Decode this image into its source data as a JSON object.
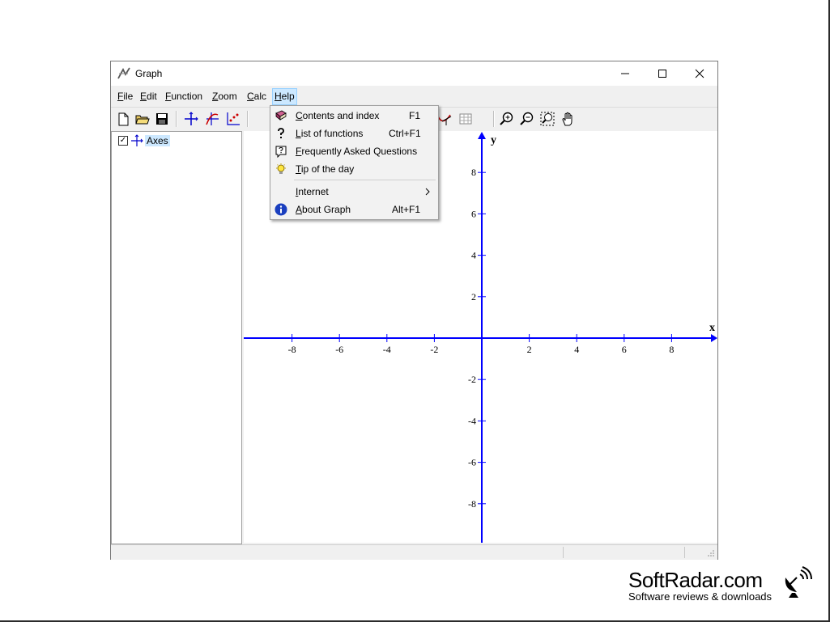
{
  "window": {
    "title": "Graph"
  },
  "menubar": [
    {
      "label": "File",
      "key": "F",
      "rest": "ile"
    },
    {
      "label": "Edit",
      "key": "E",
      "rest": "dit"
    },
    {
      "label": "Function",
      "key": "F",
      "rest": "unction"
    },
    {
      "label": "Zoom",
      "key": "Z",
      "rest": "oom"
    },
    {
      "label": "Calc",
      "key": "C",
      "rest": "alc"
    },
    {
      "label": "Help",
      "key": "H",
      "rest": "elp"
    }
  ],
  "tree": {
    "item_label": "Axes",
    "checked": true
  },
  "help_menu": {
    "items": [
      {
        "key": "C",
        "rest": "ontents and index",
        "shortcut": "F1",
        "icon": "book-icon"
      },
      {
        "key": "L",
        "rest": "ist of functions",
        "shortcut": "Ctrl+F1",
        "icon": "question-icon"
      },
      {
        "key": "F",
        "rest": "requently Asked Questions",
        "shortcut": "",
        "icon": "faq-icon"
      },
      {
        "key": "T",
        "rest": "ip of the day",
        "shortcut": "",
        "icon": "lightbulb-icon"
      },
      {
        "key": "I",
        "rest": "nternet",
        "shortcut": "",
        "icon": "",
        "submenu": true
      },
      {
        "key": "A",
        "rest": "bout Graph",
        "shortcut": "Alt+F1",
        "icon": "info-icon"
      }
    ]
  },
  "plot": {
    "x_label": "x",
    "y_label": "y",
    "x_ticks": [
      "-8",
      "-6",
      "-4",
      "-2",
      "2",
      "4",
      "6",
      "8"
    ],
    "y_ticks": [
      "8",
      "6",
      "4",
      "2",
      "-2",
      "-4",
      "-6",
      "-8"
    ],
    "axis_color": "#0000ff"
  },
  "watermark": {
    "title": "SoftRadar.com",
    "subtitle": "Software reviews & downloads"
  }
}
